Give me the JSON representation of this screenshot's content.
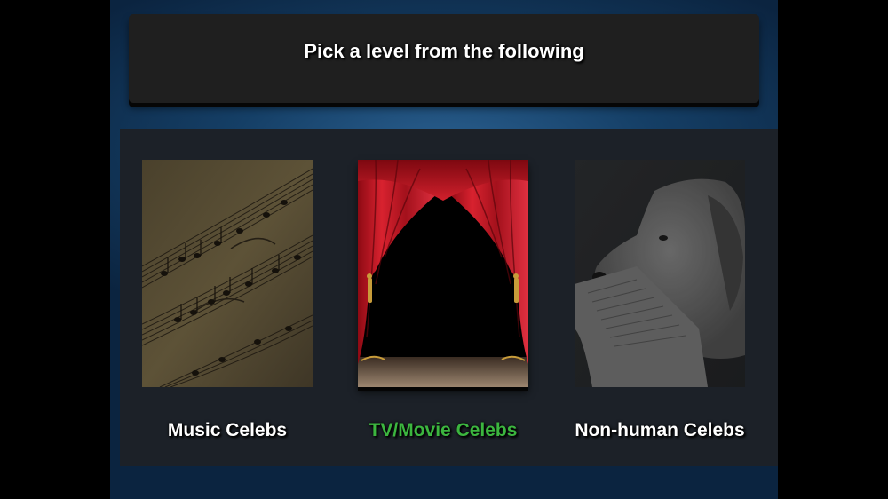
{
  "prompt": "Pick a level from the following",
  "selected_index": 1,
  "levels": [
    {
      "label": "Music Celebs",
      "image": "sheet-music"
    },
    {
      "label": "TV/Movie Celebs",
      "image": "theater-curtain"
    },
    {
      "label": "Non-human Celebs",
      "image": "dog-with-newspaper"
    }
  ],
  "colors": {
    "selected_label": "#3cb63f",
    "label": "#ffffff",
    "panel": "#1c2128",
    "header": "#1f1f1f"
  }
}
